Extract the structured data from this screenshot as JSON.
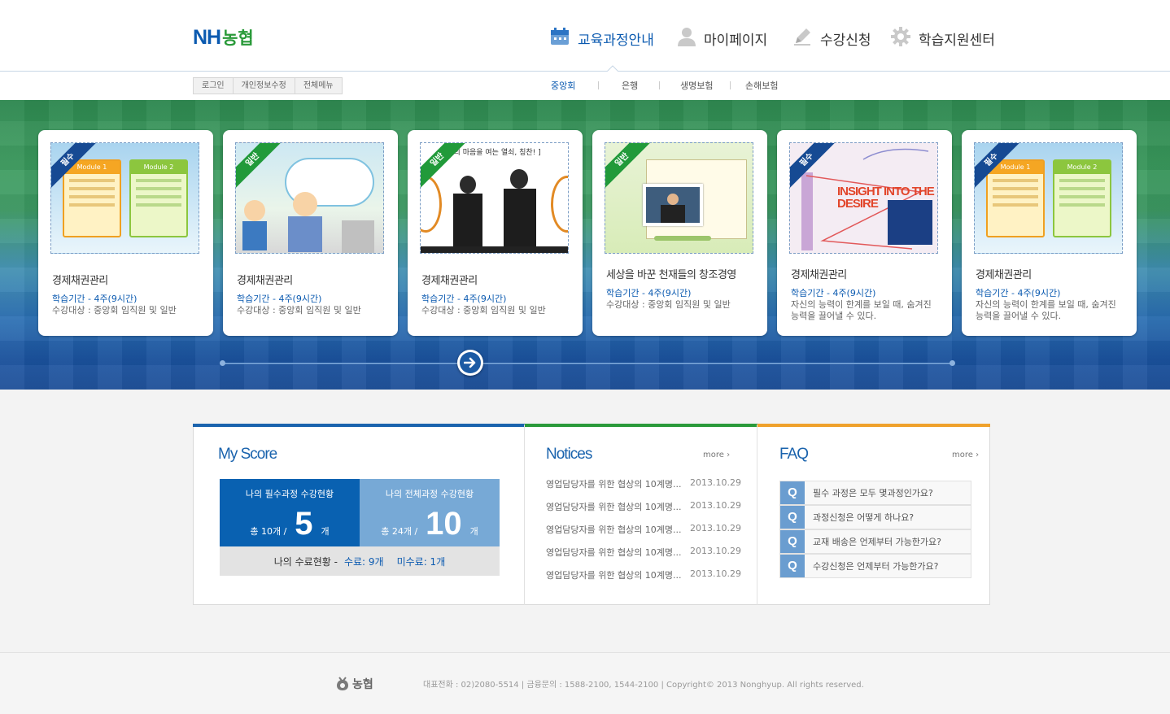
{
  "header": {
    "logo_latin": "NH",
    "logo_korean": "농협",
    "nav": [
      {
        "label": "교육과정안내",
        "icon": "calendar-icon"
      },
      {
        "label": "마이페이지",
        "icon": "user-icon"
      },
      {
        "label": "수강신청",
        "icon": "pencil-icon"
      },
      {
        "label": "학습지원센터",
        "icon": "gear-icon"
      }
    ],
    "util": [
      "로그인",
      "개인정보수정",
      "전체메뉴"
    ],
    "sub": [
      "중앙회",
      "은행",
      "생명보험",
      "손해보험"
    ]
  },
  "cards": [
    {
      "badge": "필수",
      "title": "경제채권관리",
      "period": "학습기간 - 4주(9시간)",
      "desc": "수강대상 : 중앙회 임직원 및 일반",
      "thumb": "module",
      "mod1": "Module 1",
      "mod2": "Module 2"
    },
    {
      "badge": "일반",
      "title": "경제채권관리",
      "period": "학습기간 - 4주(9시간)",
      "desc": "수강대상 : 중앙회 임직원 및 일반",
      "thumb": "cartoon"
    },
    {
      "badge": "일반",
      "title": "경제채권관리",
      "period": "학습기간 - 4주(9시간)",
      "desc": "수강대상 : 중앙회 임직원 및 일반",
      "thumb": "people",
      "thumb_text": "고객의 마음을 여는 열쇠, 칭찬! ]"
    },
    {
      "badge": "일반",
      "title": "세상을 바꾼 천재들의 창조경영",
      "period": "학습기간 - 4주(9시간)",
      "desc": "수강대상 : 중앙회 임직원 및 일반",
      "thumb": "video"
    },
    {
      "badge": "필수",
      "title": "경제채권관리",
      "period": "학습기간 - 4주(9시간)",
      "desc": "자신의 능력이 한계를 보일 때, 숨겨진 능력을 끌어낼 수 있다.",
      "thumb": "insight",
      "thumb_text": "INSIGHT INTO THE DESIRE"
    },
    {
      "badge": "필수",
      "title": "경제채권관리",
      "period": "학습기간 - 4주(9시간)",
      "desc": "자신의 능력이 한계를 보일 때, 숨겨진 능력을 끌어낼 수 있다.",
      "thumb": "module",
      "mod1": "Module 1",
      "mod2": "Module 2"
    }
  ],
  "score": {
    "title": "My Score",
    "box1": {
      "heading": "나의 필수과정 수강현황",
      "total": "총 10개 /",
      "value": "5",
      "unit": "개"
    },
    "box2": {
      "heading": "나의 전체과정 수강현황",
      "total": "총 24개 /",
      "value": "10",
      "unit": "개"
    },
    "summary_label": "나의 수료현황 -",
    "completed": "수료: 9개",
    "incomplete": "미수료: 1개"
  },
  "notices": {
    "title": "Notices",
    "more": "more ›",
    "items": [
      {
        "text": "영업담당자를 위한 협상의 10계명...",
        "date": "2013.10.29"
      },
      {
        "text": "영업담당자를 위한 협상의 10계명...",
        "date": "2013.10.29"
      },
      {
        "text": "영업담당자를 위한 협상의 10계명...",
        "date": "2013.10.29"
      },
      {
        "text": "영업담당자를 위한 협상의 10계명...",
        "date": "2013.10.29"
      },
      {
        "text": "영업담당자를 위한 협상의 10계명...",
        "date": "2013.10.29"
      }
    ]
  },
  "faq": {
    "title": "FAQ",
    "more": "more ›",
    "q": "Q",
    "items": [
      "필수 과정은 모두 몇과정인가요?",
      "과정신청은 어떻게 하나요?",
      "교재 배송은 언제부터 가능한가요?",
      "수강신청은 언제부터 가능한가요?"
    ]
  },
  "footer": {
    "logo": "농협",
    "text": "대표전화 : 02)2080-5514 | 금융문의 : 1588-2100, 1544-2100 | Copyright© 2013 Nonghyup. All rights reserved."
  },
  "colors": {
    "brand_blue": "#0b5ab0",
    "brand_green": "#2a9a3a",
    "score_bar": "#1a63ad",
    "notice_bar": "#2a9a3a",
    "faq_bar": "#efa12b"
  }
}
